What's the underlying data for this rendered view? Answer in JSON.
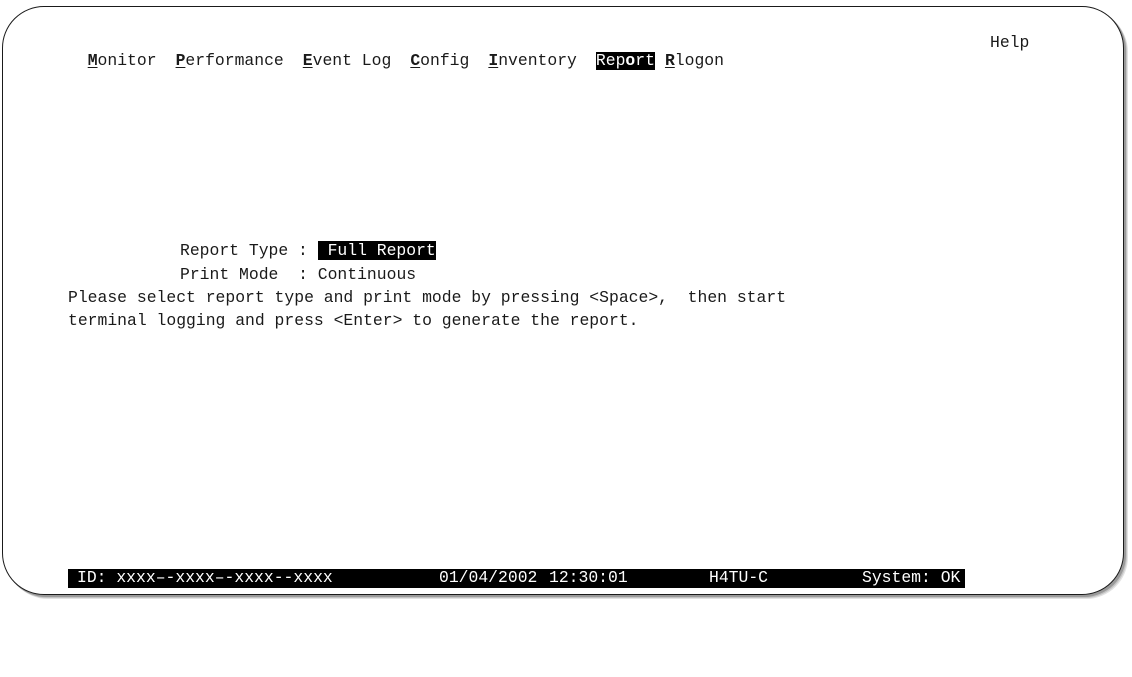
{
  "menu": {
    "items": [
      {
        "key": "M",
        "rest": "onitor"
      },
      {
        "key": "P",
        "rest": "erformance"
      },
      {
        "key": "E",
        "rest": "vent Log"
      },
      {
        "key": "C",
        "rest": "onfig"
      },
      {
        "key": "I",
        "rest": "nventory"
      },
      {
        "pre": "Rep",
        "key": "o",
        "rest": "rt"
      },
      {
        "key": "R",
        "rest": "logon"
      }
    ],
    "help": "Help"
  },
  "form": {
    "report_type_label": "Report Type",
    "report_type_value": " Full Report",
    "print_mode_label": "Print Mode",
    "print_mode_value": "Continuous",
    "separator": ":"
  },
  "instructions": {
    "line1": "Please select report type and print mode by pressing <Space>,  then start",
    "line2": "terminal logging and press <Enter> to generate the report."
  },
  "status": {
    "id": "ID: xxxx–-xxxx–-xxxx--xxxx",
    "date": "01/04/2002",
    "time": "12:30:01",
    "unit": "H4TU-C",
    "system": "System: OK"
  }
}
